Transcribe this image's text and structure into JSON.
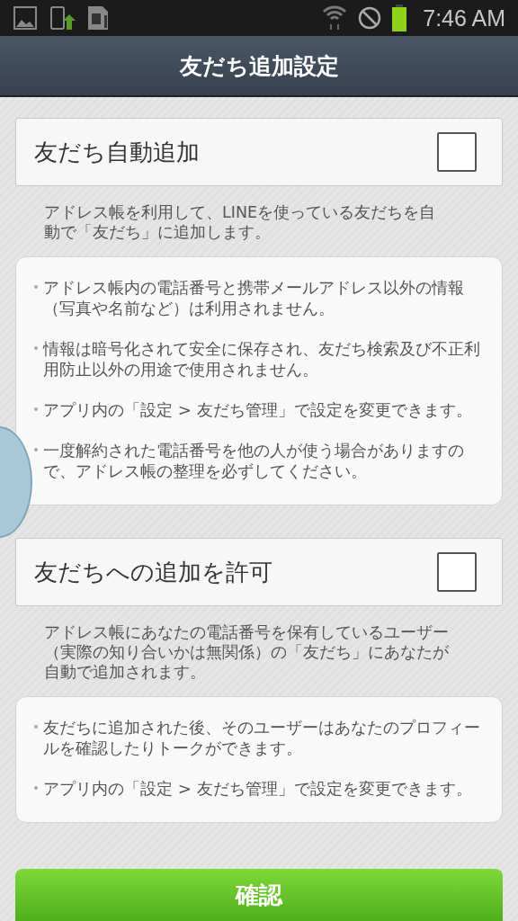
{
  "status_bar": {
    "time": "7:46 AM"
  },
  "header": {
    "title": "友だち追加設定"
  },
  "sections": [
    {
      "title": "友だち自動追加",
      "checked": false,
      "description": "アドレス帳を利用して、LINEを使っている友だちを自動で「友だち」に追加します。",
      "notes": [
        "アドレス帳内の電話番号と携帯メールアドレス以外の情報（写真や名前など）は利用されません。",
        "情報は暗号化されて安全に保存され、友だち検索及び不正利用防止以外の用途で使用されません。",
        "アプリ内の「設定 > 友だち管理」で設定を変更できます。",
        "一度解約された電話番号を他の人が使う場合がありますので、アドレス帳の整理を必ずしてください。"
      ]
    },
    {
      "title": "友だちへの追加を許可",
      "checked": false,
      "description": "アドレス帳にあなたの電話番号を保有しているユーザー（実際の知り合いかは無関係）の「友だち」にあなたが自動で追加されます。",
      "notes": [
        "友だちに追加された後、そのユーザーはあなたのプロフィールを確認したりトークができます。",
        "アプリ内の「設定 > 友だち管理」で設定を変更できます。"
      ]
    }
  ],
  "confirm_button": "確認"
}
